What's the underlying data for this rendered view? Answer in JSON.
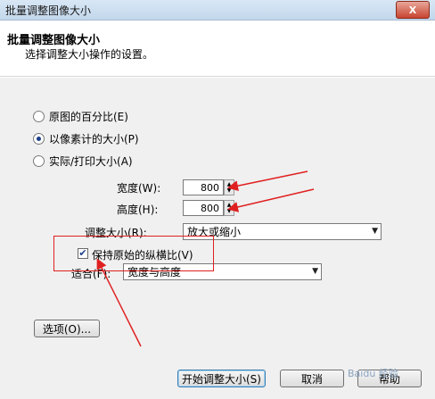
{
  "window": {
    "title": "批量调整图像大小",
    "close_symbol": "X"
  },
  "header": {
    "title": "批量调整图像大小",
    "subtitle": "选择调整大小操作的设置。"
  },
  "options": {
    "percent_label": "原图的百分比(E)",
    "pixels_label": "以像素计的大小(P)",
    "print_label": "实际/打印大小(A)",
    "selected": "pixels"
  },
  "size": {
    "width_label": "宽度(W):",
    "width_value": "800",
    "height_label": "高度(H):",
    "height_value": "800"
  },
  "resize": {
    "label": "调整大小(R):",
    "value": "放大或缩小"
  },
  "keep_ratio": {
    "label": "保持原始的纵横比(V)",
    "checked": true
  },
  "fit": {
    "label": "适合(F):",
    "value": "宽度与高度"
  },
  "buttons": {
    "options": "选项(O)...",
    "start": "开始调整大小(S)",
    "cancel": "取消",
    "help": "帮助"
  },
  "watermark": "Baidu 经验",
  "colors": {
    "annotation": "#e02020",
    "radio_dot": "#1c3f8b"
  }
}
